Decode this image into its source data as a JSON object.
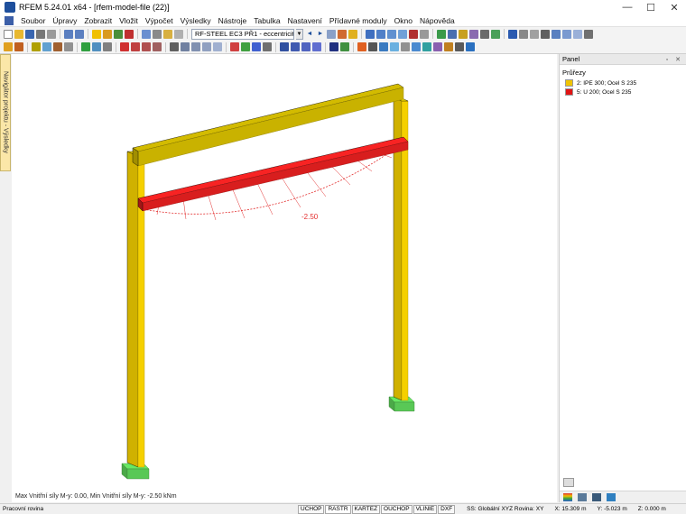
{
  "window": {
    "title": "RFEM 5.24.01 x64 - [rfem-model-file (22)]",
    "minimize": "—",
    "maximize": "☐",
    "close": "✕"
  },
  "menu": [
    "Soubor",
    "Úpravy",
    "Zobrazit",
    "Vložit",
    "Výpočet",
    "Výsledky",
    "Nástroje",
    "Tabulka",
    "Nastavení",
    "Přídavné moduly",
    "Okno",
    "Nápověda"
  ],
  "toolbar": {
    "case_combo": "RF-STEEL EC3 PŘ1 - eccentricity cancell",
    "combo_arrow": "▼",
    "nav_prev": "◄",
    "nav_next": "►"
  },
  "navigator": {
    "tab_label": "Navigátor projektu - Výsledky"
  },
  "viewport": {
    "result_value_label": "-2.50",
    "info_text": "Max Vnitřní síly M-y: 0.00, Min Vnitřní síly M-y: -2.50 kNm",
    "colors": {
      "column": "#f5d000",
      "top_beam": "#c9b200",
      "bottom_beam": "#d81e1e",
      "support": "#5ed35a",
      "diagram": "#e33030"
    }
  },
  "panel": {
    "title": "Panel",
    "header_icons": "▫ ✕",
    "section_title": "Průřezy",
    "items": [
      {
        "label": "2: IPE 300; Ocel S 235",
        "color": "#f0c400"
      },
      {
        "label": "5: U 200; Ocel S 235",
        "color": "#e01414"
      }
    ]
  },
  "statusbar": {
    "left": "Pracovní rovina",
    "toggles": [
      "UCHOP",
      "RASTR",
      "KARTEZ",
      "OUCHOP",
      "VLINIE",
      "DXF"
    ],
    "active_toggle": "RASTR",
    "ss": "SS: Globální XYZ Rovina: XY",
    "x": "X: 15.309 m",
    "y": "Y: -5.023 m",
    "z": "Z: 0.000 m"
  }
}
